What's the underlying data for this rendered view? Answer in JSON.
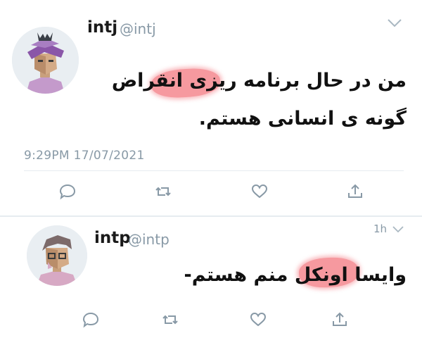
{
  "tweets": [
    {
      "name": "intj",
      "handle": "@intj",
      "time_ago": "",
      "text": "من در حال برنامه ریزی انقراض گونه ی انسانی هستم.",
      "timestamp": "9:29PM 17/07/2021"
    },
    {
      "name": "intp",
      "handle": "@intp",
      "time_ago": "1h",
      "text": "وایسا اونکل منم هستم-",
      "timestamp": ""
    }
  ],
  "icons": {
    "reply": "reply-icon",
    "retweet": "retweet-icon",
    "like": "heart-icon",
    "share": "share-icon",
    "menu": "chevron-down-icon"
  },
  "colors": {
    "muted": "#8899a6",
    "icon": "#8899a6",
    "redaction": "#ef4650"
  }
}
